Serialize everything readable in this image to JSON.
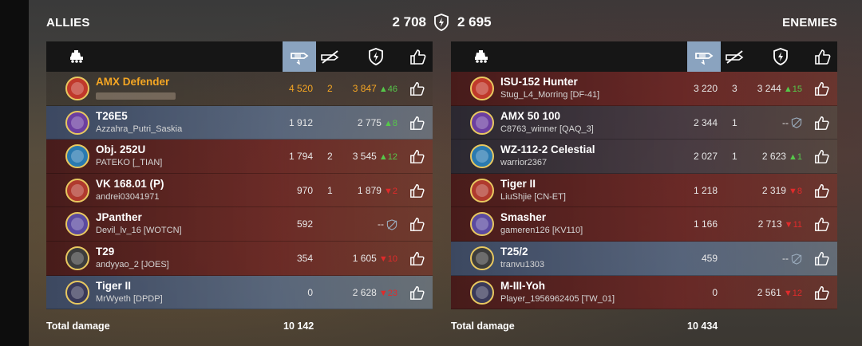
{
  "header": {
    "allies_label": "ALLIES",
    "enemies_label": "ENEMIES",
    "allies_score": "2 708",
    "enemies_score": "2 695",
    "score_icon": "rating-shield-icon"
  },
  "columns": {
    "vehicle_icon": "tank-icon",
    "damage_icon": "damage-shell-icon",
    "kills_icon": "destroyed-shell-icon",
    "rating_icon": "rating-shield-icon",
    "like_icon": "thumbs-up-icon"
  },
  "colors": {
    "self_name": "#f5a623",
    "delta_up": "#56c84a",
    "delta_down": "#e02b2b",
    "active_column": "#8aa3bf"
  },
  "allies": [
    {
      "tank": "AMX Defender",
      "player": "",
      "damage": "4 520",
      "kills": "2",
      "rating": "3 847",
      "delta": "46",
      "dir": "up",
      "self": true,
      "tint": "none"
    },
    {
      "tank": "T26E5",
      "player": "Azzahra_Putri_Saskia",
      "damage": "1 912",
      "kills": "",
      "rating": "2 775",
      "delta": "8",
      "dir": "up",
      "tint": "blue"
    },
    {
      "tank": "Obj. 252U",
      "player": "PATEKO [_TIAN]",
      "damage": "1 794",
      "kills": "2",
      "rating": "3 545",
      "delta": "12",
      "dir": "up",
      "tint": "red"
    },
    {
      "tank": "VK 168.01 (P)",
      "player": "andrei03041971",
      "damage": "970",
      "kills": "1",
      "rating": "1 879",
      "delta": "2",
      "dir": "down",
      "tint": "red"
    },
    {
      "tank": "JPanther",
      "player": "Devil_lv_16 [WOTCN]",
      "damage": "592",
      "kills": "",
      "rating": "--",
      "delta": "",
      "dir": "none",
      "tint": "red"
    },
    {
      "tank": "T29",
      "player": "andyyao_2 [JOES]",
      "damage": "354",
      "kills": "",
      "rating": "1 605",
      "delta": "10",
      "dir": "down",
      "tint": "red"
    },
    {
      "tank": "Tiger II",
      "player": "MrWyeth [DPDP]",
      "damage": "0",
      "kills": "",
      "rating": "2 628",
      "delta": "23",
      "dir": "down",
      "tint": "blue"
    }
  ],
  "enemies": [
    {
      "tank": "ISU-152 Hunter",
      "player": "Stug_L4_Morring [DF-41]",
      "damage": "3 220",
      "kills": "3",
      "rating": "3 244",
      "delta": "15",
      "dir": "up",
      "tint": "red"
    },
    {
      "tank": "AMX 50 100",
      "player": "C8763_winner [QAQ_3]",
      "damage": "2 344",
      "kills": "1",
      "rating": "--",
      "delta": "",
      "dir": "none",
      "tint": "dark"
    },
    {
      "tank": "WZ-112-2 Celestial",
      "player": "warrior2367",
      "damage": "2 027",
      "kills": "1",
      "rating": "2 623",
      "delta": "1",
      "dir": "up",
      "tint": "dark"
    },
    {
      "tank": "Tiger II",
      "player": "LiuShjie [CN-ET]",
      "damage": "1 218",
      "kills": "",
      "rating": "2 319",
      "delta": "8",
      "dir": "down",
      "tint": "red"
    },
    {
      "tank": "Smasher",
      "player": "gameren126 [KV110]",
      "damage": "1 166",
      "kills": "",
      "rating": "2 713",
      "delta": "11",
      "dir": "down",
      "tint": "red"
    },
    {
      "tank": "T25/2",
      "player": "tranvu1303",
      "damage": "459",
      "kills": "",
      "rating": "--",
      "delta": "",
      "dir": "none",
      "tint": "blue"
    },
    {
      "tank": "M-III-Yoh",
      "player": "Player_1956962405 [TW_01]",
      "damage": "0",
      "kills": "",
      "rating": "2 561",
      "delta": "12",
      "dir": "down",
      "tint": "red"
    }
  ],
  "totals": {
    "label": "Total damage",
    "allies": "10 142",
    "enemies": "10 434"
  }
}
